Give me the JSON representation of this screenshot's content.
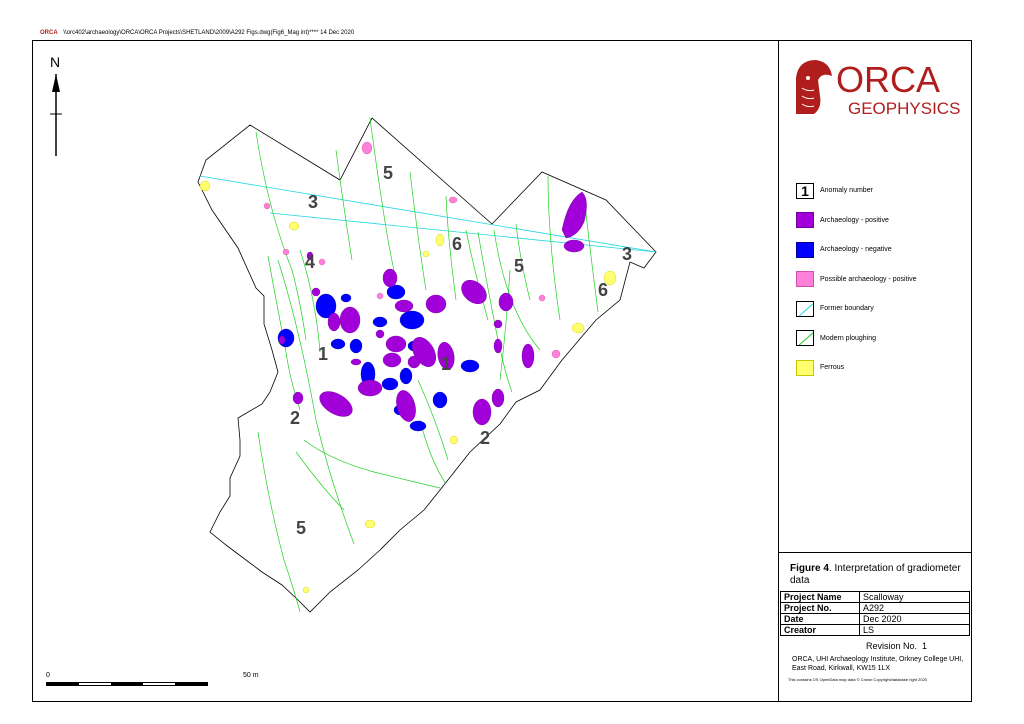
{
  "header": {
    "logo_mini": "ORCA",
    "file_path": "\\\\orc402\\archaeology\\ORCA\\ORCA Projects\\SHETLAND\\2009\\A292 Figs.dwg(Fig6_Mag int)**** 14 Dec 2020"
  },
  "north_arrow": {
    "label": "N"
  },
  "scale_bar": {
    "start_label": "0",
    "end_label": "50 m",
    "segments": 5
  },
  "logo": {
    "word1": "ORCA",
    "word2": "GEOPHYSICS",
    "color": "#b01d1d"
  },
  "legend": {
    "items": [
      {
        "type": "number",
        "symbol": "1",
        "label": "Anomaly number"
      },
      {
        "type": "fill",
        "color": "#a100d8",
        "label": "Archaeology - positive"
      },
      {
        "type": "fill",
        "color": "#0000ff",
        "label": "Archaeology - negative"
      },
      {
        "type": "fill",
        "color": "#ff80d8",
        "label": "Possible archaeology - positive"
      },
      {
        "type": "line",
        "color": "#20d8e0",
        "label": "Former boundary"
      },
      {
        "type": "line",
        "color": "#20d020",
        "label": "Modern ploughing"
      },
      {
        "type": "fill",
        "color": "#ffff70",
        "label": "Ferrous"
      }
    ]
  },
  "figure": {
    "number": "Figure 4",
    "caption": ". Interpretation of gradiometer data"
  },
  "info": {
    "rows": [
      {
        "key": "Project Name",
        "value": "Scalloway"
      },
      {
        "key": "Project No.",
        "value": "A292"
      },
      {
        "key": "Date",
        "value": "Dec 2020"
      },
      {
        "key": "Creator",
        "value": "LS"
      }
    ],
    "revision_label": "Revision No.",
    "revision_value": "1"
  },
  "address": "ORCA, UHI Archaeology Institute, Orkney College UHI, East Road, Kirkwall, KW15 1LX",
  "copyright": "This contains OS OpenData map data © Crown Copyright/database right 2020",
  "map": {
    "anomaly_labels": [
      "5",
      "3",
      "6",
      "5",
      "3",
      "6",
      "4",
      "1",
      "1",
      "2",
      "2",
      "5"
    ]
  }
}
